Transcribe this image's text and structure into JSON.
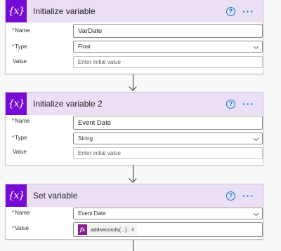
{
  "cards": [
    {
      "title": "Initialize variable",
      "icon": "{x}",
      "fields": {
        "name": {
          "label": "Name",
          "value": "VarDate"
        },
        "type": {
          "label": "Type",
          "value": "Float"
        },
        "value": {
          "label": "Value",
          "placeholder": "Enter initial value"
        }
      }
    },
    {
      "title": "Initialize variable 2",
      "icon": "{x}",
      "fields": {
        "name": {
          "label": "Name",
          "value": "Event Date"
        },
        "type": {
          "label": "Type",
          "value": "String"
        },
        "value": {
          "label": "Value",
          "placeholder": "Enter initial value"
        }
      }
    },
    {
      "title": "Set variable",
      "icon": "{x}",
      "fields": {
        "name": {
          "label": "Name",
          "value": "Event Date"
        },
        "value": {
          "label": "Value",
          "token_icon": "fx",
          "token_text": "addseconds(...)",
          "token_remove": "×"
        }
      }
    }
  ],
  "help_icon": "?",
  "more_icon": "···",
  "required_marker": "*",
  "colors": {
    "header_bg": "#ebdff6",
    "icon_bg": "#770bd6",
    "accent": "#0078d4",
    "fx_token": "#8b1f8f"
  }
}
